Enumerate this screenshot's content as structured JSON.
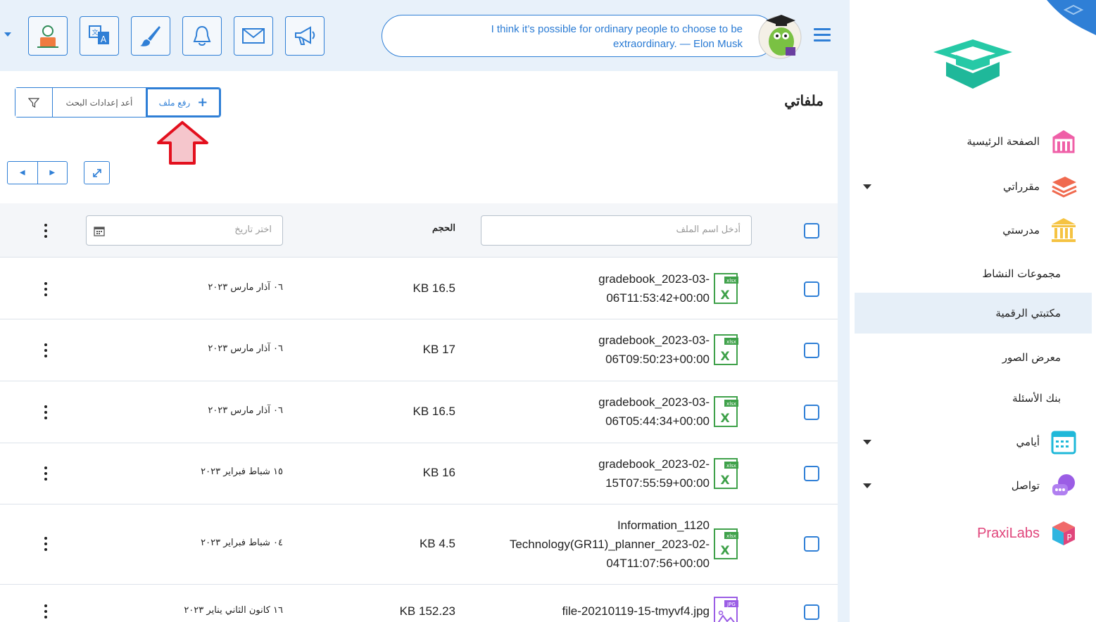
{
  "header": {
    "quote": "I think it’s possible for ordinary people to choose to be extraordinary. — Elon Musk",
    "buttons": [
      "profile-icon",
      "translate-icon",
      "brush-icon",
      "bell-icon",
      "mail-icon",
      "megaphone-icon"
    ]
  },
  "sidebar": {
    "items": [
      {
        "label": "الصفحة الرئيسية",
        "icon": "school-building-icon",
        "color": "#ef5fa7"
      },
      {
        "label": "مقرراتي",
        "icon": "books-stack-icon",
        "color": "#f06a4f"
      },
      {
        "label": "مدرستي",
        "icon": "institution-icon",
        "color": "#f5c342"
      },
      {
        "label": "مجموعات النشاط"
      },
      {
        "label": "مكتبتي الرقمية"
      },
      {
        "label": "معرض الصور"
      },
      {
        "label": "بنك الأسئلة"
      },
      {
        "label": "أيامي",
        "icon": "calendar-icon",
        "color": "#1fb8d9"
      },
      {
        "label": "تواصل",
        "icon": "chat-icon",
        "color": "#9b5de5"
      }
    ],
    "praxilabs": "PraxiLabs"
  },
  "main": {
    "title": "ملفاتي",
    "upload_label": "رفع ملف",
    "reset_label": "أعد إعدادات البحث"
  },
  "table": {
    "name_placeholder": "أدخل اسم الملف",
    "size_header": "الحجم",
    "date_placeholder": "اختر تاريخ",
    "rows": [
      {
        "name_lines": [
          "gradebook_2023-03-",
          "06T11:53:42+00:00"
        ],
        "type": "xlsx",
        "size": "16.5 KB",
        "date": "٠٦ آذار مارس ٢٠٢٣"
      },
      {
        "name_lines": [
          "gradebook_2023-03-",
          "06T09:50:23+00:00"
        ],
        "type": "xlsx",
        "size": "17 KB",
        "date": "٠٦ آذار مارس ٢٠٢٣"
      },
      {
        "name_lines": [
          "gradebook_2023-03-",
          "06T05:44:34+00:00"
        ],
        "type": "xlsx",
        "size": "16.5 KB",
        "date": "٠٦ آذار مارس ٢٠٢٣"
      },
      {
        "name_lines": [
          "gradebook_2023-02-",
          "15T07:55:59+00:00"
        ],
        "type": "xlsx",
        "size": "16 KB",
        "date": "١٥ شباط فبراير ٢٠٢٣"
      },
      {
        "name_lines": [
          "Information_1120",
          "Technology(GR11)_planner_2023-02-",
          "04T11:07:56+00:00"
        ],
        "type": "xlsx",
        "size": "4.5 KB",
        "date": "٠٤ شباط فبراير ٢٠٢٣"
      },
      {
        "name_lines": [
          "file-20210119-15-tmyvf4.jpg"
        ],
        "type": "jpg",
        "size": "152.23 KB",
        "date": "١٦ كانون الثاني يناير ٢٠٢٣"
      }
    ]
  },
  "colors": {
    "accent": "#2f7fd6",
    "excel": "#3fa14a",
    "logo": "#26c9a6"
  }
}
